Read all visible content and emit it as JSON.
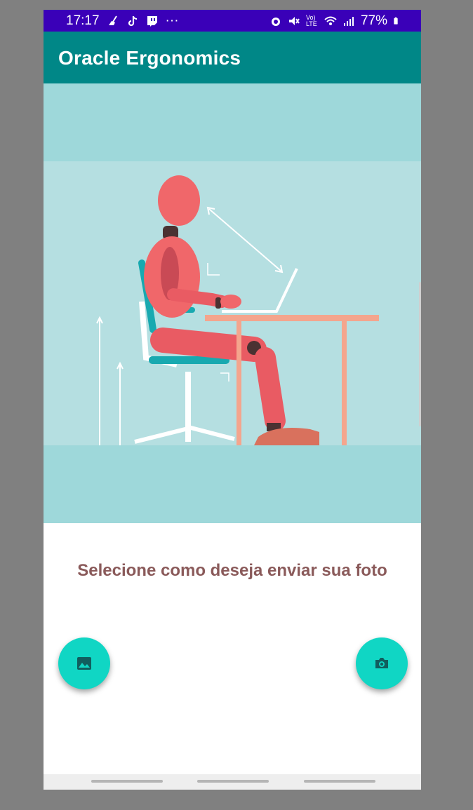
{
  "status_bar": {
    "time": "17:17",
    "more": "···",
    "network_label": "Vo) LTE",
    "battery_percent": "77%",
    "left_icons": [
      "broom-icon",
      "tiktok-icon",
      "twitch-icon"
    ],
    "right_icons": [
      "alarm-icon",
      "mute-icon",
      "volte-icon",
      "wifi-icon",
      "signal-icon",
      "battery-icon"
    ]
  },
  "app_bar": {
    "title": "Oracle Ergonomics"
  },
  "main": {
    "illustration": "ergonomic-sitting-posture-illustration",
    "prompt": "Selecione como deseja enviar sua foto"
  },
  "actions": {
    "gallery_icon": "image-icon",
    "camera_icon": "camera-icon"
  },
  "colors": {
    "status_bar": "#3a00b8",
    "app_bar": "#008787",
    "fab": "#10d6c4",
    "hero_bg": "#9ed8da",
    "prompt_text": "#8a5a5a"
  }
}
